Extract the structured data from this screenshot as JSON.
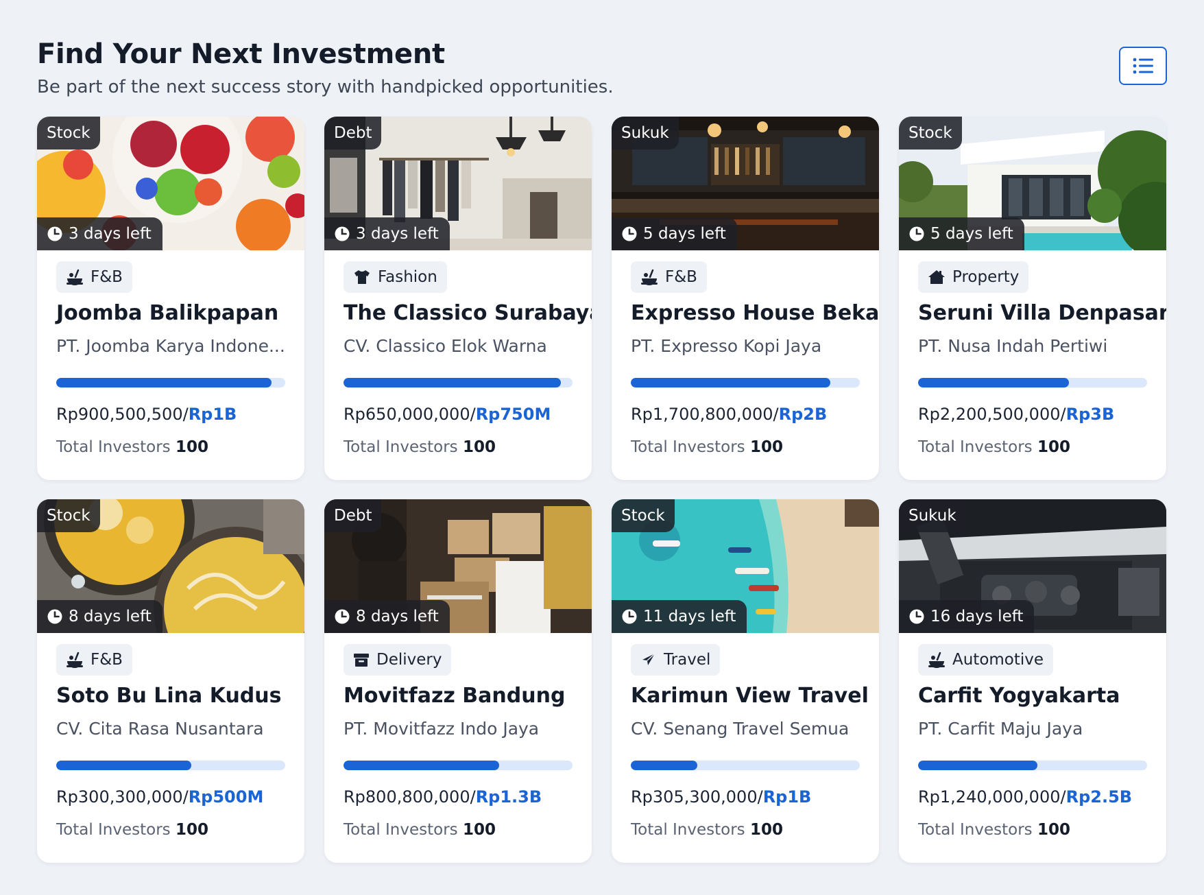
{
  "header": {
    "title": "Find Your Next Investment",
    "subtitle": "Be part of the next success story with handpicked opportunities.",
    "view_toggle_icon": "list-icon"
  },
  "colors": {
    "accent": "#1b64d6",
    "track": "#dbe7fb",
    "page_bg": "#eef1f6"
  },
  "cards": [
    {
      "type": "Stock",
      "days_left": "3 days left",
      "category": "F&B",
      "category_icon": "food-icon",
      "title": "Joomba Balikpapan",
      "company": "PT. Joomba Karya Indone...",
      "progress": 0.94,
      "raised": "Rp900,500,500",
      "separator": "/",
      "target": "Rp1B",
      "investors_label": "Total Investors",
      "investors_count": "100"
    },
    {
      "type": "Debt",
      "days_left": "3 days left",
      "category": "Fashion",
      "category_icon": "shirt-icon",
      "title": "The Classico Surabaya",
      "company": "CV. Classico Elok Warna",
      "progress": 0.95,
      "raised": "Rp650,000,000",
      "separator": "/",
      "target": "Rp750M",
      "investors_label": "Total Investors",
      "investors_count": "100"
    },
    {
      "type": "Sukuk",
      "days_left": "5 days left",
      "category": "F&B",
      "category_icon": "food-icon",
      "title": "Expresso House Bekasi",
      "company": "PT. Expresso Kopi Jaya",
      "progress": 0.87,
      "raised": "Rp1,700,800,000",
      "separator": "/",
      "target": "Rp2B",
      "investors_label": "Total Investors",
      "investors_count": "100"
    },
    {
      "type": "Stock",
      "days_left": "5 days left",
      "category": "Property",
      "category_icon": "house-icon",
      "title": "Seruni Villa Denpasar",
      "company": "PT. Nusa Indah Pertiwi",
      "progress": 0.66,
      "raised": "Rp2,200,500,000",
      "separator": "/",
      "target": "Rp3B",
      "investors_label": "Total Investors",
      "investors_count": "100"
    },
    {
      "type": "Stock",
      "days_left": "8 days left",
      "category": "F&B",
      "category_icon": "food-icon",
      "title": "Soto Bu Lina Kudus",
      "company": "CV. Cita Rasa Nusantara",
      "progress": 0.59,
      "raised": "Rp300,300,000",
      "separator": "/",
      "target": "Rp500M",
      "investors_label": "Total Investors",
      "investors_count": "100"
    },
    {
      "type": "Debt",
      "days_left": "8 days left",
      "category": "Delivery",
      "category_icon": "box-icon",
      "title": "Movitfazz Bandung",
      "company": "PT. Movitfazz Indo Jaya",
      "progress": 0.68,
      "raised": "Rp800,800,000",
      "separator": "/",
      "target": "Rp1.3B",
      "investors_label": "Total Investors",
      "investors_count": "100"
    },
    {
      "type": "Stock",
      "days_left": "11 days left",
      "category": "Travel",
      "category_icon": "plane-icon",
      "title": "Karimun View Travel",
      "company": "CV. Senang Travel Semua",
      "progress": 0.29,
      "raised": "Rp305,300,000",
      "separator": "/",
      "target": "Rp1B",
      "investors_label": "Total Investors",
      "investors_count": "100"
    },
    {
      "type": "Sukuk",
      "days_left": "16 days left",
      "category": "Automotive",
      "category_icon": "car-icon",
      "title": "Carfit Yogyakarta",
      "company": "PT. Carfit Maju Jaya",
      "progress": 0.52,
      "raised": "Rp1,240,000,000",
      "separator": "/",
      "target": "Rp2.5B",
      "investors_label": "Total Investors",
      "investors_count": "100"
    }
  ]
}
